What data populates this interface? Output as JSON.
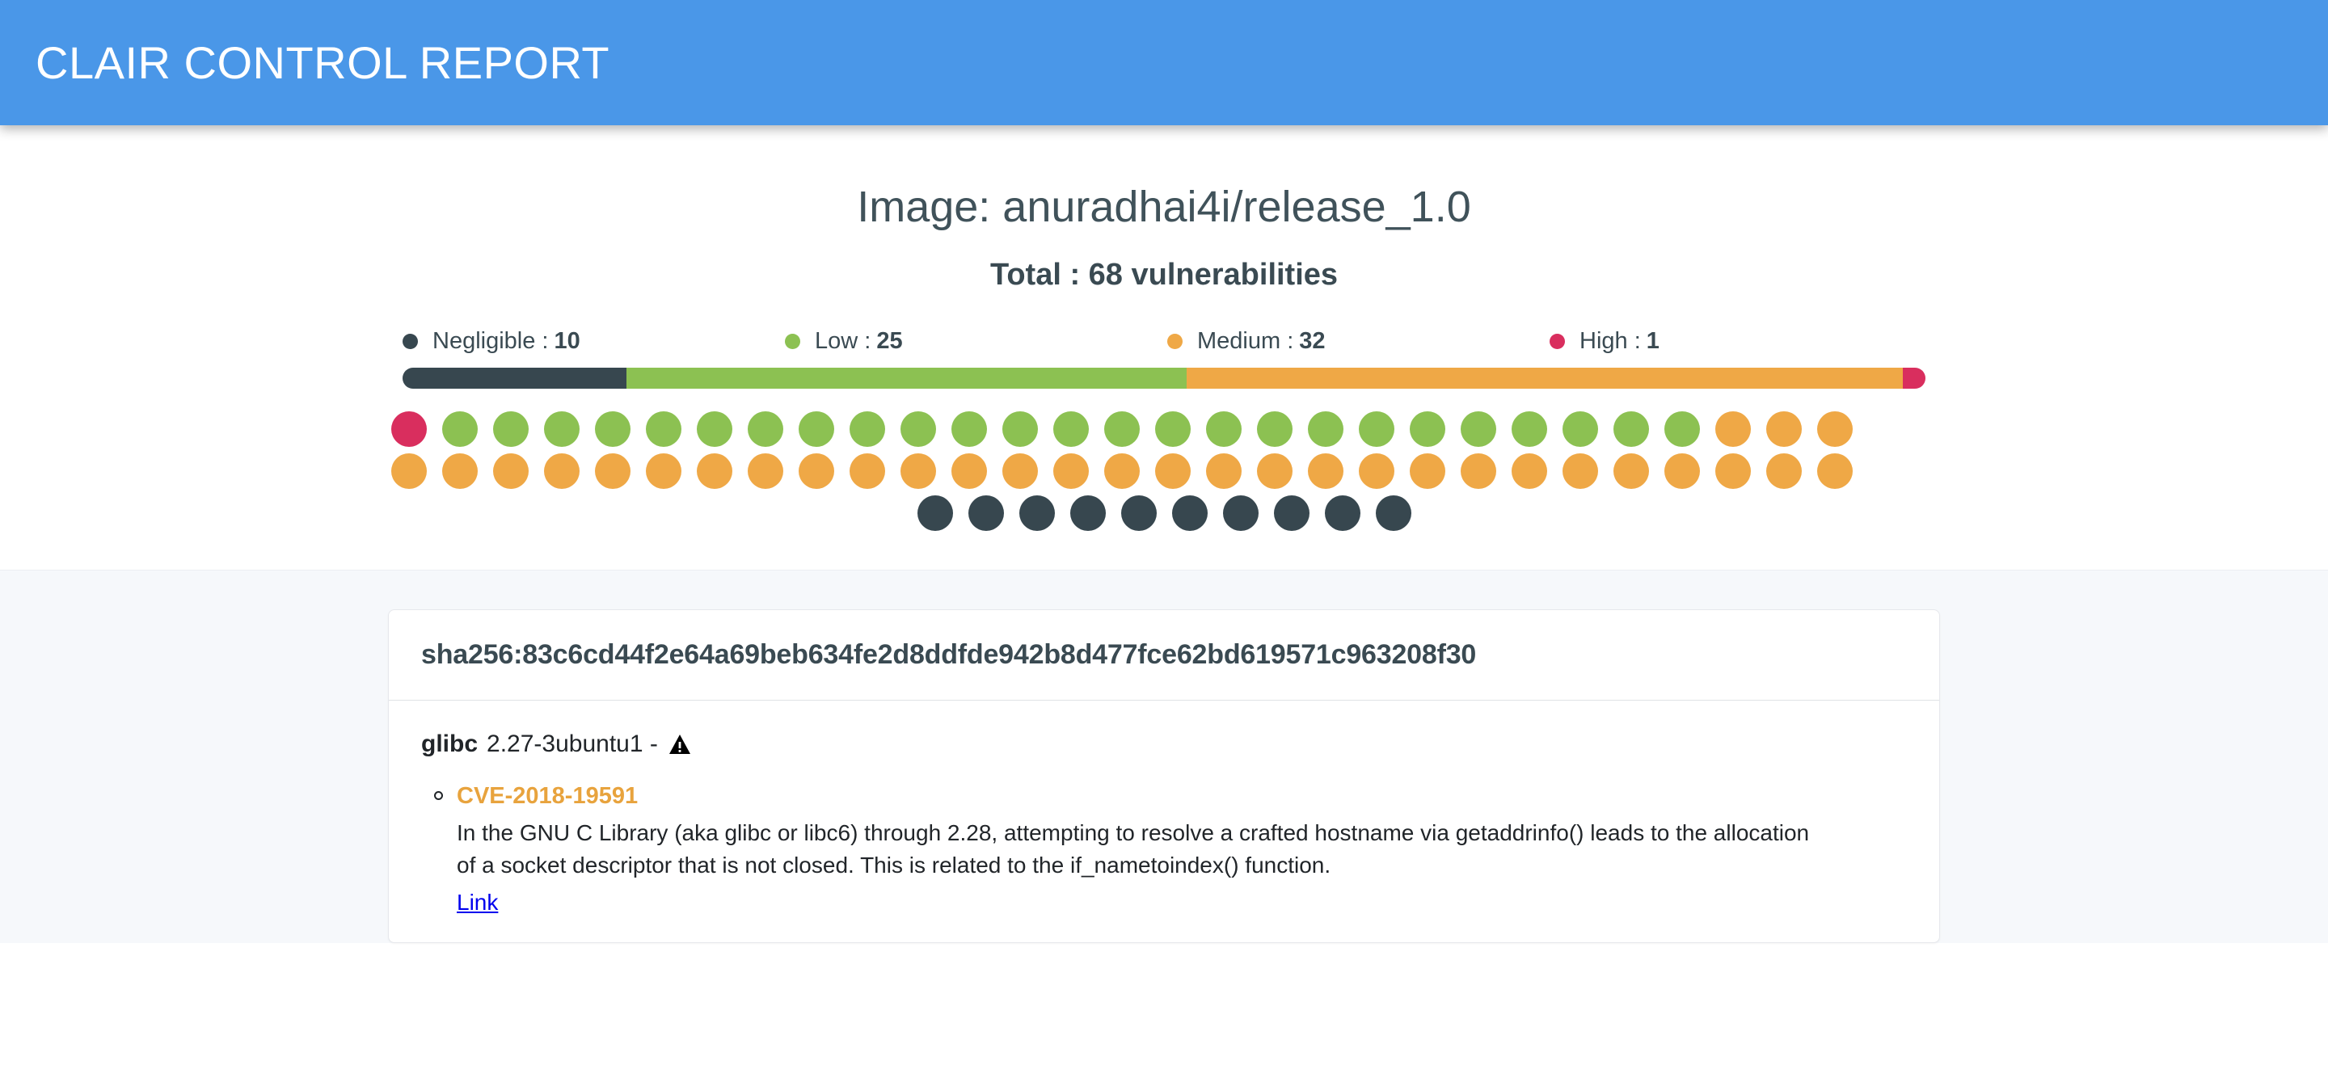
{
  "appbar": {
    "title": "CLAIR CONTROL REPORT",
    "background_color": "#4a97e8"
  },
  "summary": {
    "image_title": "Image: anuradhai4i/release_1.0",
    "total_title": "Total : 68 vulnerabilities"
  },
  "chart_data": {
    "type": "bar",
    "title": "Total : 68 vulnerabilities",
    "subtitle": "Image: anuradhai4i/release_1.0",
    "categories": [
      "Negligible",
      "Low",
      "Medium",
      "High"
    ],
    "values": [
      10,
      25,
      32,
      1
    ],
    "colors": [
      "#37474f",
      "#8cc152",
      "#efa846",
      "#d92e5e"
    ],
    "total": 68,
    "xlabel": "",
    "ylabel": "",
    "legend_position": "top",
    "grid": false,
    "stacked_bar_order": [
      "Negligible",
      "Low",
      "Medium",
      "High"
    ],
    "dot_matrix": {
      "dot_order": [
        "High",
        "Low",
        "Medium",
        "Negligible"
      ],
      "rows": [
        [
          "High",
          "Low",
          "Low",
          "Low",
          "Low",
          "Low",
          "Low",
          "Low",
          "Low",
          "Low",
          "Low",
          "Low",
          "Low",
          "Low",
          "Low",
          "Low",
          "Low",
          "Low",
          "Low",
          "Low",
          "Low",
          "Low",
          "Low",
          "Low",
          "Low",
          "Low",
          "Medium",
          "Medium",
          "Medium"
        ],
        [
          "Medium",
          "Medium",
          "Medium",
          "Medium",
          "Medium",
          "Medium",
          "Medium",
          "Medium",
          "Medium",
          "Medium",
          "Medium",
          "Medium",
          "Medium",
          "Medium",
          "Medium",
          "Medium",
          "Medium",
          "Medium",
          "Medium",
          "Medium",
          "Medium",
          "Medium",
          "Medium",
          "Medium",
          "Medium",
          "Medium",
          "Medium",
          "Medium",
          "Medium"
        ],
        [
          "Negligible",
          "Negligible",
          "Negligible",
          "Negligible",
          "Negligible",
          "Negligible",
          "Negligible",
          "Negligible",
          "Negligible",
          "Negligible"
        ]
      ]
    }
  },
  "legend": [
    {
      "label": "Negligible :",
      "count": "10",
      "color": "#37474f"
    },
    {
      "label": "Low :",
      "count": "25",
      "color": "#8cc152"
    },
    {
      "label": "Medium :",
      "count": "32",
      "color": "#efa846"
    },
    {
      "label": "High :",
      "count": "1",
      "color": "#d92e5e"
    }
  ],
  "details": {
    "layer_sha": "sha256:83c6cd44f2e64a69beb634fe2d8ddfde942b8d477fce62bd619571c963208f30",
    "package": {
      "name": "glibc",
      "version": "2.27-3ubuntu1 -",
      "warning_icon": "warning-triangle-icon"
    },
    "vulnerabilities": [
      {
        "id": "CVE-2018-19591",
        "description": "In the GNU C Library (aka glibc or libc6) through 2.28, attempting to resolve a crafted hostname via getaddrinfo() leads to the allocation of a socket descriptor that is not closed. This is related to the if_nametoindex() function.",
        "link_label": "Link"
      }
    ]
  }
}
